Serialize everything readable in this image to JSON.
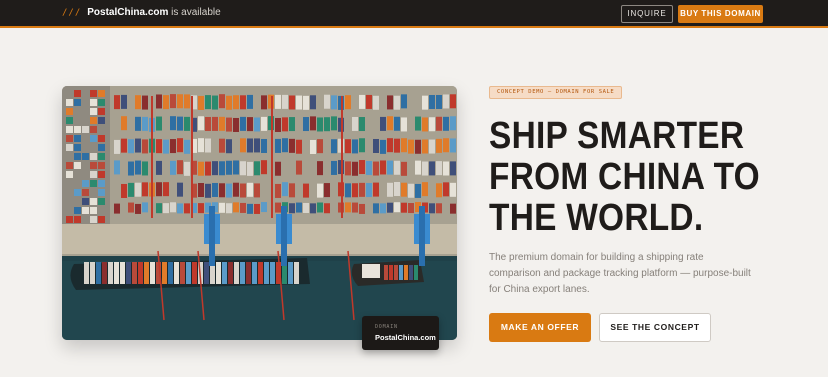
{
  "header": {
    "slashes": "///",
    "domain": "PostalChina.com",
    "suffix": " is available",
    "inquire_label": "INQUIRE",
    "buy_label": "BUY THIS DOMAIN"
  },
  "hero": {
    "image_alt": "Aerial view of container port with cranes and cargo ships",
    "domain_tag_label": "DOMAIN",
    "domain_tag_value": "PostalChina.com"
  },
  "content": {
    "badge": "CONCEPT DEMO — DOMAIN FOR SALE",
    "headline_lines": [
      "SHIP SMARTER",
      "FROM CHINA TO",
      "THE WORLD."
    ],
    "description": "The premium domain for building a shipping rate comparison and package tracking platform — purpose-built for China export lanes.",
    "offer_label": "MAKE AN OFFER",
    "concept_label": "SEE THE CONCEPT"
  },
  "colors": {
    "accent": "#d97a12",
    "dark": "#1f1c1a",
    "background": "#f3f1ee"
  }
}
